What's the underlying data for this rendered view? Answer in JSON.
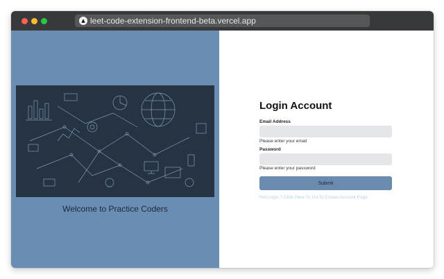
{
  "browser": {
    "url": "leet-code-extension-frontend-beta.vercel.app",
    "site_icon": "vercel-triangle-icon"
  },
  "left": {
    "welcome": "Welcome to Practice Coders",
    "hero_image": "tech-doodle-illustration",
    "hero_colors": {
      "bg": "#263342",
      "line": "#8fb0cc"
    }
  },
  "login": {
    "title": "Login Account",
    "email_label": "Email Address",
    "email_value": "",
    "email_hint": "Please enter your email",
    "password_label": "Password",
    "password_value": "",
    "password_hint": "Please enter your password",
    "submit_label": "Submit",
    "create_account_link": "Not Login ? Click Here To Go To Create Account Page"
  },
  "colors": {
    "panel_blue": "#6a8db3",
    "button": "#6a8bad",
    "input_bg": "#e5e6ea",
    "link": "#b6d0ea"
  }
}
